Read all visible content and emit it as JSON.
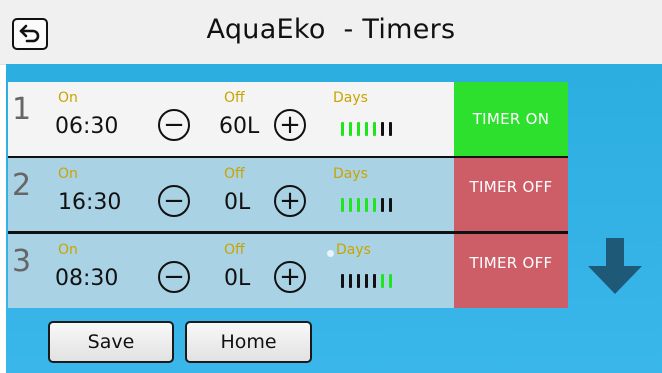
{
  "header": {
    "title": "AquaEko  - Timers"
  },
  "labels": {
    "on": "On",
    "off": "Off",
    "days": "Days"
  },
  "colors": {
    "day_active": "#1ee61e",
    "day_inactive": "#111111",
    "status_on_bg": "#2ee02e",
    "status_off_bg": "#cd5e67",
    "row_first_bg": "#f4f4f4",
    "row_bg": "#a9d2e4"
  },
  "timers": [
    {
      "num": "1",
      "on": "06:30",
      "off": "60L",
      "status": "TIMER ON",
      "days": [
        true,
        true,
        true,
        true,
        true,
        false,
        false
      ]
    },
    {
      "num": "2",
      "on": "16:30",
      "off": "0L",
      "status": "TIMER OFF",
      "days": [
        true,
        true,
        true,
        true,
        true,
        false,
        false
      ]
    },
    {
      "num": "3",
      "on": "08:30",
      "off": "0L",
      "status": "TIMER OFF",
      "days": [
        false,
        false,
        false,
        false,
        false,
        true,
        true
      ]
    }
  ],
  "buttons": {
    "save": "Save",
    "home": "Home"
  },
  "icons": {
    "back": "back-arrow-icon",
    "scroll": "arrow-down-icon"
  }
}
